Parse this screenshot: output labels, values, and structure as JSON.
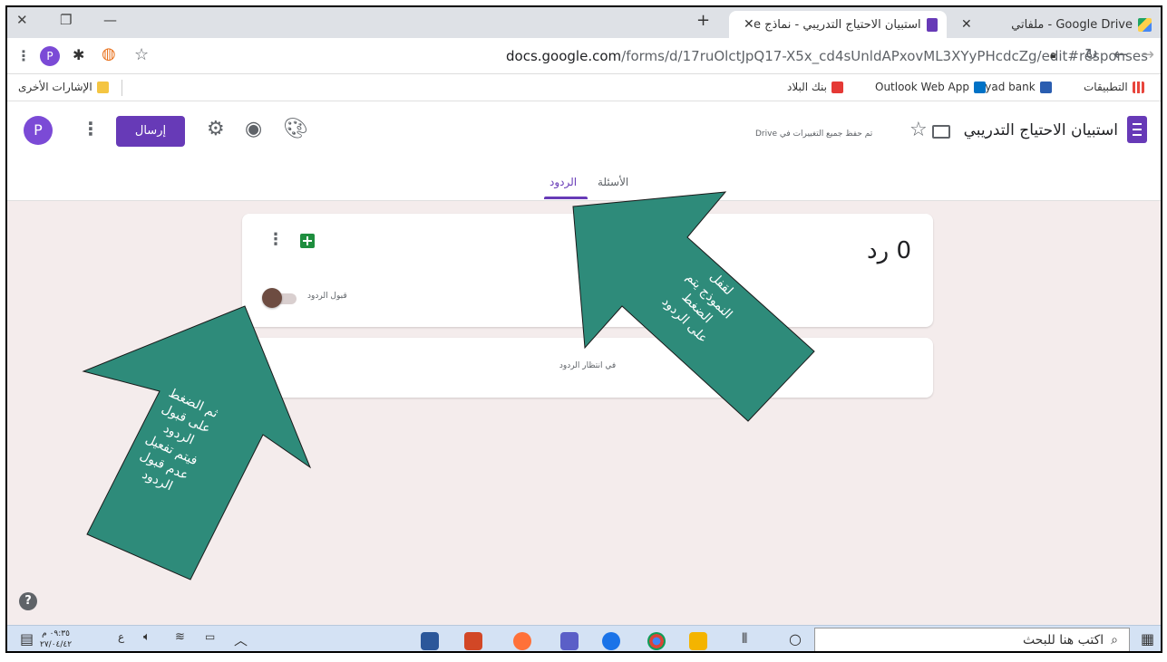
{
  "browser": {
    "tabs": [
      {
        "label": "Google Drive - ملفاتي",
        "fav_color": "#1fa463"
      },
      {
        "label": "استبيان الاحتياج التدريبي - نماذج Google",
        "fav_color": "#673ab7"
      }
    ],
    "new_tab_label": "+",
    "url_main": "docs.google.com",
    "url_path": "/forms/d/17ruOlctJpQ17-X5x_cd4sUnldAPxovML3XYyPHcdcZg/edit#responses",
    "profile_initial": "P",
    "bookmarks": [
      {
        "label": "التطبيقات",
        "color": "#e8453c"
      },
      {
        "label": "riyad bank",
        "color": "#2a5db0"
      },
      {
        "label": "Outlook Web App",
        "color": "#0072c6"
      },
      {
        "label": "بنك البلاد",
        "color": "#e53935"
      }
    ],
    "other_bookmarks": "الإشارات الأخرى"
  },
  "form": {
    "title": "استبيان الاحتياج التدريبي",
    "saved_status": "تم حفظ جميع التغييرات في Drive",
    "send_label": "إرسال",
    "avatar_initial": "P",
    "tabs": {
      "questions": "الأسئلة",
      "responses": "الردود"
    },
    "response_count": "0 رد",
    "accept_label": "قبول الردود",
    "waiting_label": "في انتظار الردود",
    "accent": "#673ab7"
  },
  "annotations": {
    "right_arrow_text": "لقفل\nالنموذج يتم\nالضغط\nعلى الردود",
    "left_arrow_text": "ثم الضغط\nعلى قبول\nالردود\nفيتم تفعيل\nعدم قبول\nالردود",
    "arrow_color": "#2e8b7a"
  },
  "taskbar": {
    "search_placeholder": "اكتب هنا للبحث",
    "time": "٠٩:٣٥ م",
    "date": "٢٧/٠٤/٤٢",
    "lang": "ع"
  }
}
